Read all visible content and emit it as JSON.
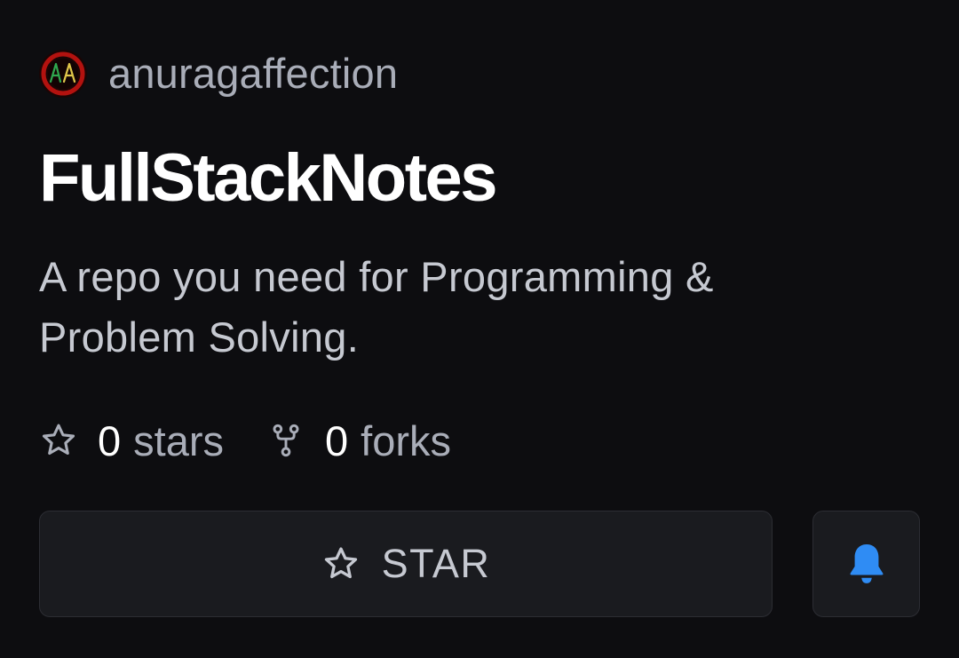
{
  "owner": {
    "name": "anuragaffection",
    "avatar_initials": "AA",
    "avatar_colors": {
      "bg": "#1a0505",
      "ring": "#b3120f",
      "accent_green": "#2fa84f",
      "accent_red": "#e03a2a"
    }
  },
  "repo": {
    "name": "FullStackNotes",
    "description": "A repo you need for Programming & Problem Solving."
  },
  "stats": {
    "stars": {
      "count": "0",
      "label": "stars",
      "icon": "star-outline-icon"
    },
    "forks": {
      "count": "0",
      "label": "forks",
      "icon": "fork-icon"
    }
  },
  "actions": {
    "star_label": "STAR",
    "star_icon": "star-outline-icon",
    "notify_icon": "bell-icon",
    "notify_color": "#2f8cf4"
  },
  "colors": {
    "background": "#0d0d10",
    "button_bg": "#1a1b1f",
    "text_primary": "#ffffff",
    "text_secondary": "#a9adb8"
  }
}
